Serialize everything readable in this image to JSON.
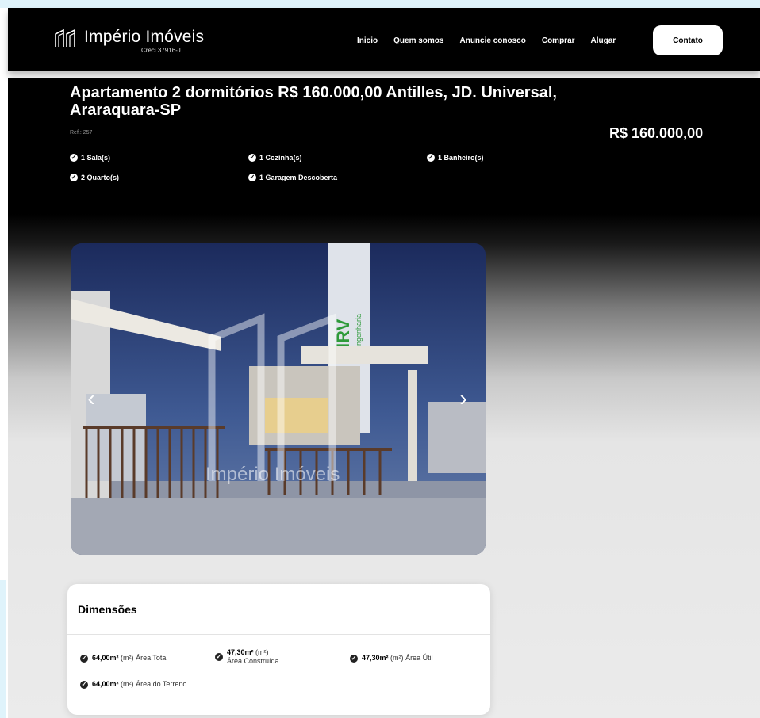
{
  "brand": {
    "name": "Império Imóveis",
    "creci": "Creci 37916-J",
    "logo_icon": "double-square-arch-logo"
  },
  "nav": {
    "links": [
      "Inicio",
      "Quem somos",
      "Anuncie conosco",
      "Comprar",
      "Alugar"
    ],
    "contact": "Contato"
  },
  "property": {
    "title": "Apartamento 2 dormitórios R$ 160.000,00 Antilles, JD. Universal, Araraquara-SP",
    "ref": "Ref.: 257",
    "price": "R$ 160.000,00",
    "features": [
      "1 Sala(s)",
      "1 Cozinha(s)",
      "1 Banheiro(s)",
      "2 Quarto(s)",
      "1 Garagem Descoberta"
    ]
  },
  "gallery": {
    "watermark": "Império Imóveis",
    "prev_icon": "chevron-left-icon",
    "next_icon": "chevron-right-icon",
    "tower_text": "MRV",
    "tower_subtext": "Engenharia"
  },
  "dimensions": {
    "title": "Dimensões",
    "items": [
      {
        "value": "64,00m²",
        "unit": "(m²)",
        "label": "Área Total"
      },
      {
        "value": "47,30m²",
        "unit": "(m²)",
        "label": "Área Construída"
      },
      {
        "value": "47,30m²",
        "unit": "(m²)",
        "label": "Área Útil"
      },
      {
        "value": "64,00m²",
        "unit": "(m²)",
        "label": "Área do Terreno"
      }
    ]
  },
  "colors": {
    "background": "#000000",
    "accent": "#ffffff",
    "frame": "#dff3fb",
    "mrv_green": "#2e9a3a"
  }
}
